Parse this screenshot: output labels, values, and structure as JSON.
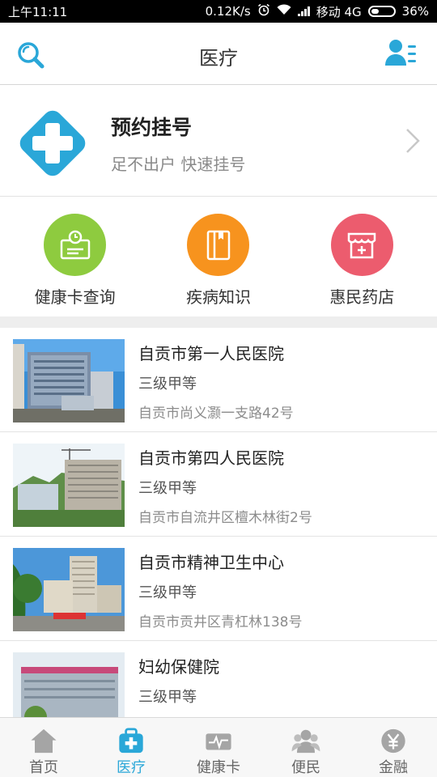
{
  "status_bar": {
    "time": "上午11:11",
    "speed": "0.12K/s",
    "carrier": "移动 4G",
    "battery": "36%",
    "battery_level": 0.36
  },
  "header": {
    "title": "医疗",
    "search_icon": "search-icon",
    "profile_icon": "user-list-icon"
  },
  "appointment": {
    "title": "预约挂号",
    "subtitle": "足不出户 快速挂号",
    "icon": "medical-cross-icon"
  },
  "services": [
    {
      "label": "健康卡查询",
      "icon": "health-card-icon",
      "color": "#8ecb3f"
    },
    {
      "label": "疾病知识",
      "icon": "book-icon",
      "color": "#f7931e"
    },
    {
      "label": "惠民药店",
      "icon": "pharmacy-icon",
      "color": "#ec5c6e"
    }
  ],
  "hospitals": [
    {
      "name": "自贡市第一人民医院",
      "level": "三级甲等",
      "address": "自贡市尚义灏一支路42号"
    },
    {
      "name": "自贡市第四人民医院",
      "level": "三级甲等",
      "address": "自贡市自流井区檀木林街2号"
    },
    {
      "name": "自贡市精神卫生中心",
      "level": "三级甲等",
      "address": "自贡市贡井区青杠林138号"
    },
    {
      "name": "妇幼保健院",
      "level": "三级甲等",
      "address": ""
    }
  ],
  "bottom_nav": [
    {
      "label": "首页",
      "icon": "home-icon",
      "active": false
    },
    {
      "label": "医疗",
      "icon": "medical-kit-icon",
      "active": true
    },
    {
      "label": "健康卡",
      "icon": "heartbeat-card-icon",
      "active": false
    },
    {
      "label": "便民",
      "icon": "people-icon",
      "active": false
    },
    {
      "label": "金融",
      "icon": "yen-icon",
      "active": false
    }
  ],
  "colors": {
    "accent": "#2aa7d8",
    "inactive": "#a5a5a5"
  }
}
